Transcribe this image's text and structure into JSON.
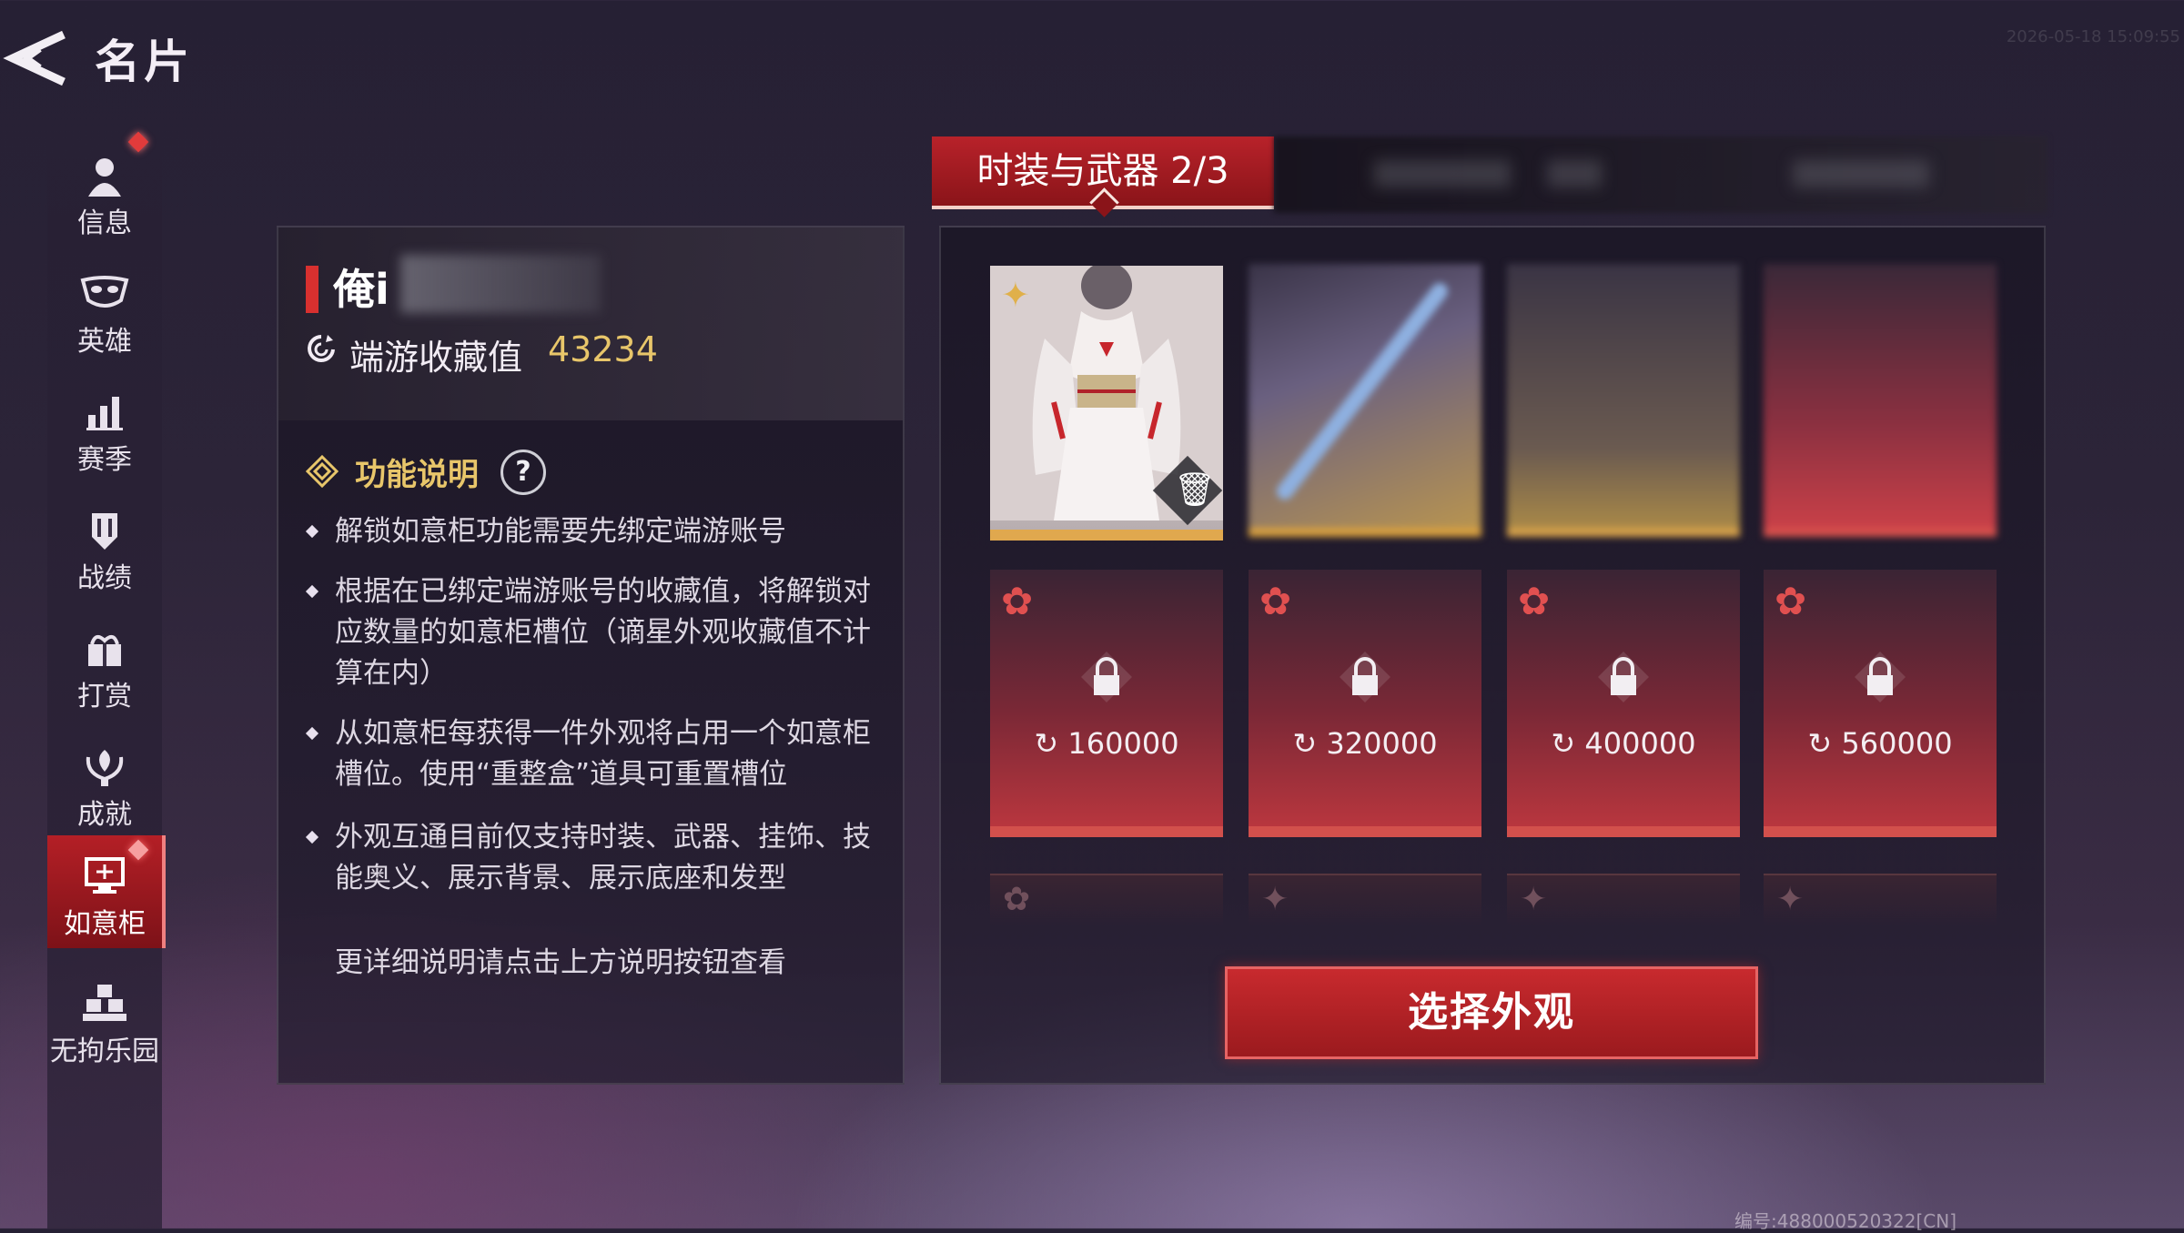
{
  "header": {
    "title": "名片",
    "timestamp": "2026-05-18 15:09:55"
  },
  "sidebar": {
    "items": [
      {
        "label": "信息",
        "icon": "person-icon",
        "badge": true,
        "active": false
      },
      {
        "label": "英雄",
        "icon": "mask-icon",
        "badge": false,
        "active": false
      },
      {
        "label": "赛季",
        "icon": "bar-chart-icon",
        "badge": false,
        "active": false
      },
      {
        "label": "战绩",
        "icon": "shield-icon",
        "badge": false,
        "active": false
      },
      {
        "label": "打赏",
        "icon": "gift-icon",
        "badge": false,
        "active": false
      },
      {
        "label": "成就",
        "icon": "trophy-icon",
        "badge": false,
        "active": false
      },
      {
        "label": "如意柜",
        "icon": "cabinet-icon",
        "badge": true,
        "active": true
      },
      {
        "label": "无拘乐园",
        "icon": "cubes-icon",
        "badge": false,
        "active": false
      }
    ]
  },
  "profile": {
    "name_visible": "俺i",
    "collection_label": "端游收藏值",
    "collection_value": "43234"
  },
  "info": {
    "title": "功能说明",
    "help": "?",
    "bullets": [
      "解锁如意柜功能需要先绑定端游账号",
      "根据在已绑定端游账号的收藏值，将解锁对应数量的如意柜槽位（谪星外观收藏值不计算在内）",
      "从如意柜每获得一件外观将占用一个如意柜槽位。使用“重整盒”道具可重置槽位",
      "外观互通目前仅支持时装、武器、挂饰、技能奥义、展示背景、展示底座和发型"
    ],
    "more": "更详细说明请点击上方说明按钮查看"
  },
  "tabs": {
    "active_label": "时装与武器 2/3"
  },
  "slots": {
    "locked": [
      {
        "cost": "160000"
      },
      {
        "cost": "320000"
      },
      {
        "cost": "400000"
      },
      {
        "cost": "560000"
      }
    ]
  },
  "action": {
    "select_label": "选择外观"
  },
  "footer": {
    "serial": "编号:488000520322[CN]"
  },
  "colors": {
    "accent_red": "#b8222a",
    "gold": "#e8c66a",
    "locked_bottom": "#d2504c"
  }
}
